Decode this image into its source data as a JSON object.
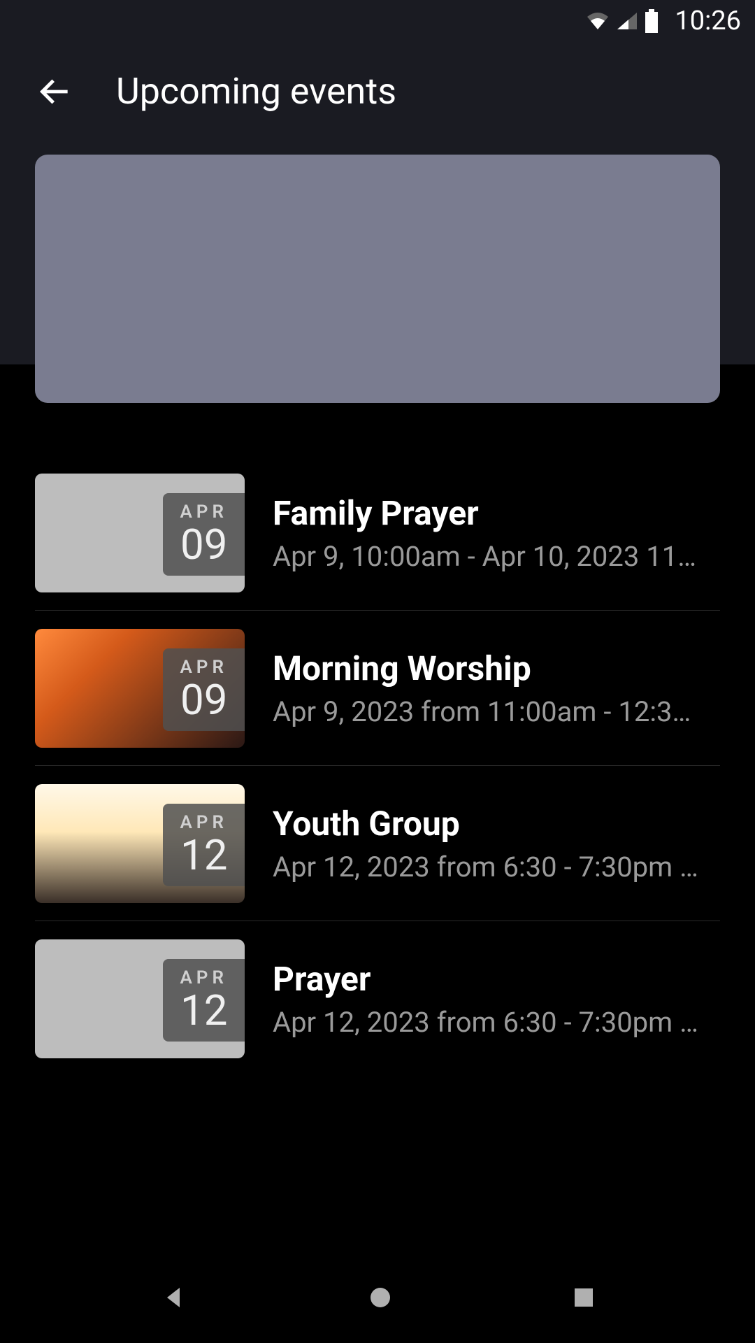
{
  "status": {
    "time": "10:26"
  },
  "header": {
    "title": "Upcoming events"
  },
  "events": [
    {
      "month": "APR",
      "day": "09",
      "title": "Family Prayer",
      "subtitle": "Apr 9, 10:00am - Apr 10, 2023 11…",
      "thumb_style": "plain"
    },
    {
      "month": "APR",
      "day": "09",
      "title": "Morning Worship",
      "subtitle": "Apr 9, 2023 from 11:00am - 12:3…",
      "thumb_style": "worship-bg"
    },
    {
      "month": "APR",
      "day": "12",
      "title": "Youth Group",
      "subtitle": "Apr 12, 2023 from 6:30 - 7:30pm …",
      "thumb_style": "youth-bg"
    },
    {
      "month": "APR",
      "day": "12",
      "title": "Prayer",
      "subtitle": "Apr 12, 2023 from 6:30 - 7:30pm …",
      "thumb_style": "plain"
    }
  ]
}
